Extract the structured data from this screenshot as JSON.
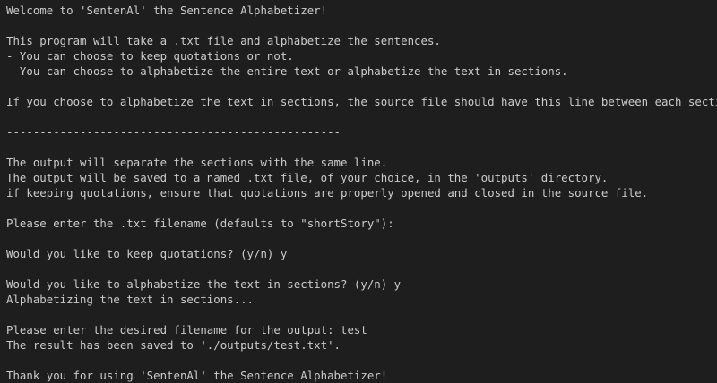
{
  "terminal": {
    "lines": [
      "Welcome to 'SentenAl' the Sentence Alphabetizer!",
      "",
      "This program will take a .txt file and alphabetize the sentences.",
      "- You can choose to keep quotations or not.",
      "- You can choose to alphabetize the entire text or alphabetize the text in sections.",
      "",
      "If you choose to alphabetize the text in sections, the source file should have this line between each section:",
      "",
      "--------------------------------------------------",
      "",
      "The output will separate the sections with the same line.",
      "The output will be saved to a named .txt file, of your choice, in the 'outputs' directory.",
      "if keeping quotations, ensure that quotations are properly opened and closed in the source file.",
      "",
      "Please enter the .txt filename (defaults to \"shortStory\"):",
      "",
      "Would you like to keep quotations? (y/n) y",
      "",
      "Would you like to alphabetize the text in sections? (y/n) y",
      "Alphabetizing the text in sections...",
      "",
      "Please enter the desired filename for the output: test",
      "The result has been saved to './outputs/test.txt'.",
      "",
      "Thank you for using 'SentenAl' the Sentence Alphabetizer!"
    ]
  },
  "colors": {
    "background": "#1e1e1e",
    "text": "#cccccc"
  }
}
